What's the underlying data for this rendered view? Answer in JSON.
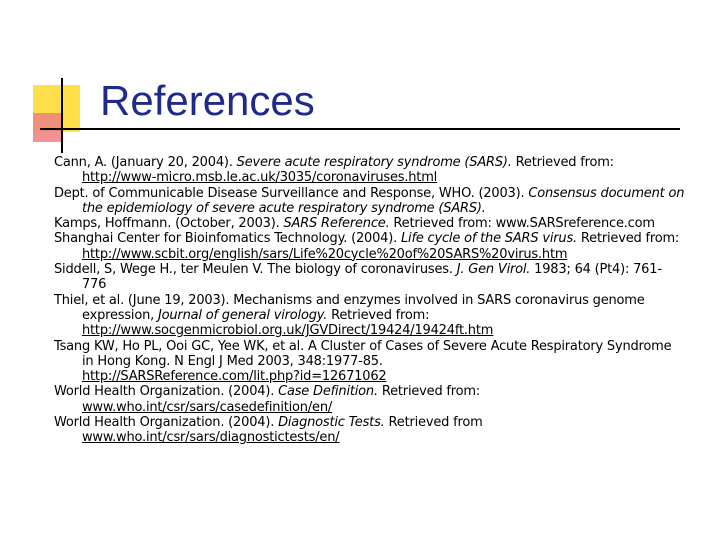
{
  "slide": {
    "title": "References",
    "references": [
      {
        "before": "Cann, A. (January 20, 2004). ",
        "italic": "Severe acute respiratory syndrome (SARS).",
        "after": " Retrieved from: ",
        "link": "http://www-micro.msb.le.ac.uk/3035/coronaviruses.html"
      },
      {
        "before": "Dept. of Communicable Disease Surveillance and Response, WHO. (2003). ",
        "italic": "Consensus document on the epidemiology of severe acute respiratory syndrome (SARS).",
        "after": "",
        "link": ""
      },
      {
        "before": "Kamps, Hoffmann. (October, 2003). ",
        "italic": "SARS Reference.",
        "after": " Retrieved from: www.SARSreference.com",
        "link": ""
      },
      {
        "before": "Shanghai Center for Bioinfomatics Technology. (2004). ",
        "italic": "Life cycle of the SARS virus.",
        "after": " Retrieved from:",
        "link": "http://www.scbit.org/english/sars/Life%20cycle%20of%20SARS%20virus.htm"
      },
      {
        "before": "Siddell, S, Wege H., ter Meulen V. The biology of coronaviruses. ",
        "italic": "J. Gen Virol.",
        "after": " 1983; 64 (Pt4): 761-776",
        "link": ""
      },
      {
        "before": "Thiel, et al. (June 19, 2003). Mechanisms and enzymes involved in SARS coronavirus genome expression, ",
        "italic": "Journal of general virology.",
        "after": " Retrieved from:",
        "link": "http://www.socgenmicrobiol.org.uk/JGVDirect/19424/19424ft.htm"
      },
      {
        "before": "Tsang KW, Ho PL, Ooi GC, Yee WK, et al. A Cluster of Cases of Severe Acute Respiratory Syndrome in Hong Kong. N Engl J Med 2003, 348:1977-85.",
        "italic": "",
        "after": "",
        "link": "http://SARSReference.com/lit.php?id=12671062"
      },
      {
        "before": "World Health Organization. (2004). ",
        "italic": "Case Definition.",
        "after": " Retrieved from:",
        "link": "www.who.int/csr/sars/casedefinition/en/"
      },
      {
        "before": "World Health Organization. (2004). ",
        "italic": "Diagnostic Tests.",
        "after": " Retrieved from",
        "link": "www.who.int/csr/sars/diagnostictests/en/"
      }
    ]
  },
  "colors": {
    "title": "#1f2b8a",
    "accent_yellow": "#ffe04a",
    "accent_red": "#f08080"
  }
}
